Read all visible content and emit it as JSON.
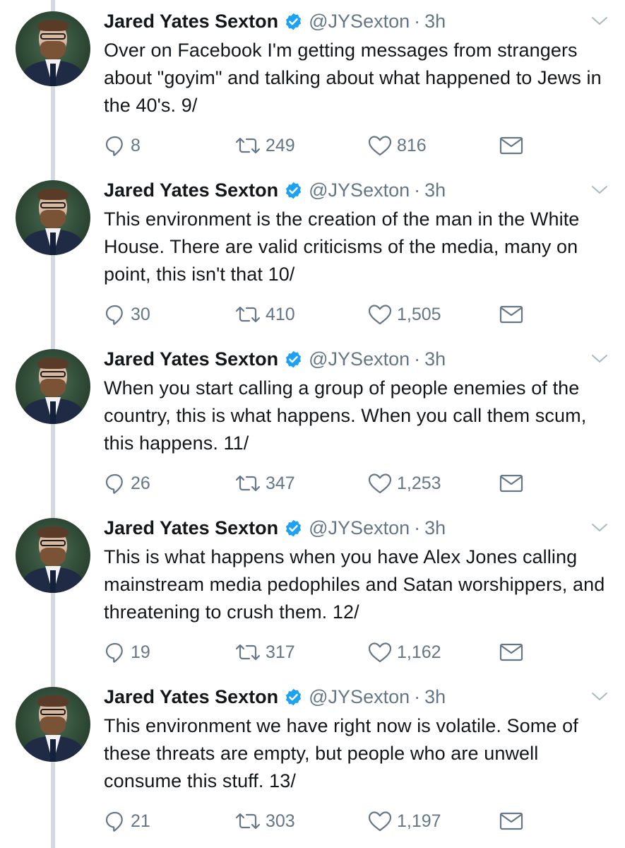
{
  "author": {
    "name": "Jared Yates Sexton",
    "handle": "@JYSexton",
    "separator": "·"
  },
  "colors": {
    "text": "#14171a",
    "muted": "#657786",
    "verified": "#1da1f2",
    "thread_line": "#d4dadf"
  },
  "icons": {
    "reply": "reply-icon",
    "retweet": "retweet-icon",
    "like": "heart-icon",
    "dm": "envelope-icon",
    "verified": "verified-badge-icon",
    "caret": "chevron-down-icon"
  },
  "tweets": [
    {
      "time": "3h",
      "text": "Over on Facebook I'm getting messages from strangers about \"goyim\" and talking about what happened to Jews in the 40's. 9/",
      "replies": "8",
      "retweets": "249",
      "likes": "816"
    },
    {
      "time": "3h",
      "text": "This environment is the creation of the man in the White House. There are valid criticisms of the media, many on point, this isn't that 10/",
      "replies": "30",
      "retweets": "410",
      "likes": "1,505"
    },
    {
      "time": "3h",
      "text": "When you start calling a group of people enemies of the country, this is what happens. When you call them scum, this happens. 11/",
      "replies": "26",
      "retweets": "347",
      "likes": "1,253"
    },
    {
      "time": "3h",
      "text": "This is what happens when you have Alex Jones calling mainstream media pedophiles and Satan worshippers, and threatening to crush them. 12/",
      "replies": "19",
      "retweets": "317",
      "likes": "1,162"
    },
    {
      "time": "3h",
      "text": "This environment we have right now is volatile. Some of these threats are empty, but people who are unwell consume this stuff. 13/",
      "replies": "21",
      "retweets": "303",
      "likes": "1,197"
    }
  ]
}
